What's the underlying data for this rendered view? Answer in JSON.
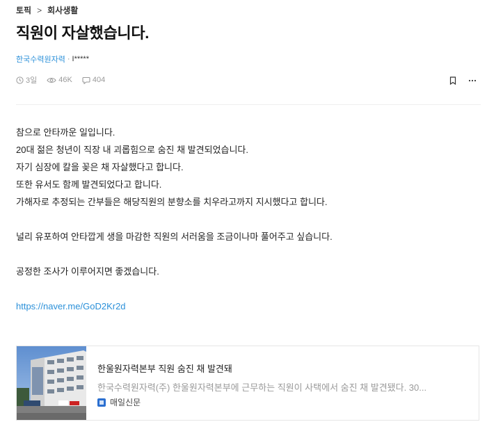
{
  "breadcrumb": {
    "root": "토픽",
    "category": "회사생활"
  },
  "post": {
    "title": "직원이 자살했습니다.",
    "company": "한국수력원자력",
    "separator": "·",
    "nickname": "I*****",
    "time": "3일",
    "views": "46K",
    "comments": "404",
    "body_lines": [
      "참으로 안타까운 일입니다.",
      "20대 젊은 청년이 직장 내 괴롭힘으로 숨진 채 발견되었습니다.",
      "자기 심장에 칼을 꽂은 채 자살했다고 합니다.",
      "또한 유서도 함께 발견되었다고 합니다.",
      "가해자로 추정되는 간부들은 해당직원의 분향소를 치우라고까지 지시했다고 합니다.",
      "널리 유포하여 안타깝게 생을 마감한 직원의 서러움을 조금이나마 풀어주고 싶습니다.",
      "공정한 조사가 이루어지면 좋겠습니다."
    ],
    "link": "https://naver.me/GoD2Kr2d"
  },
  "link_card": {
    "title": "한울원자력본부 직원 숨진 채 발견돼",
    "description": "한국수력원자력(주) 한울원자력본부에 근무하는 직원이 사택에서 숨진 채 발견됐다. 30...",
    "source": "매일신문"
  },
  "icons": {
    "breadcrumb_sep": "chevron-right-icon",
    "time": "clock-icon",
    "views": "eye-icon",
    "comments": "comment-icon",
    "bookmark": "bookmark-icon",
    "more": "more-icon"
  },
  "colors": {
    "accent": "#2b90d9",
    "muted": "#9a9a9a",
    "text": "#222222"
  }
}
